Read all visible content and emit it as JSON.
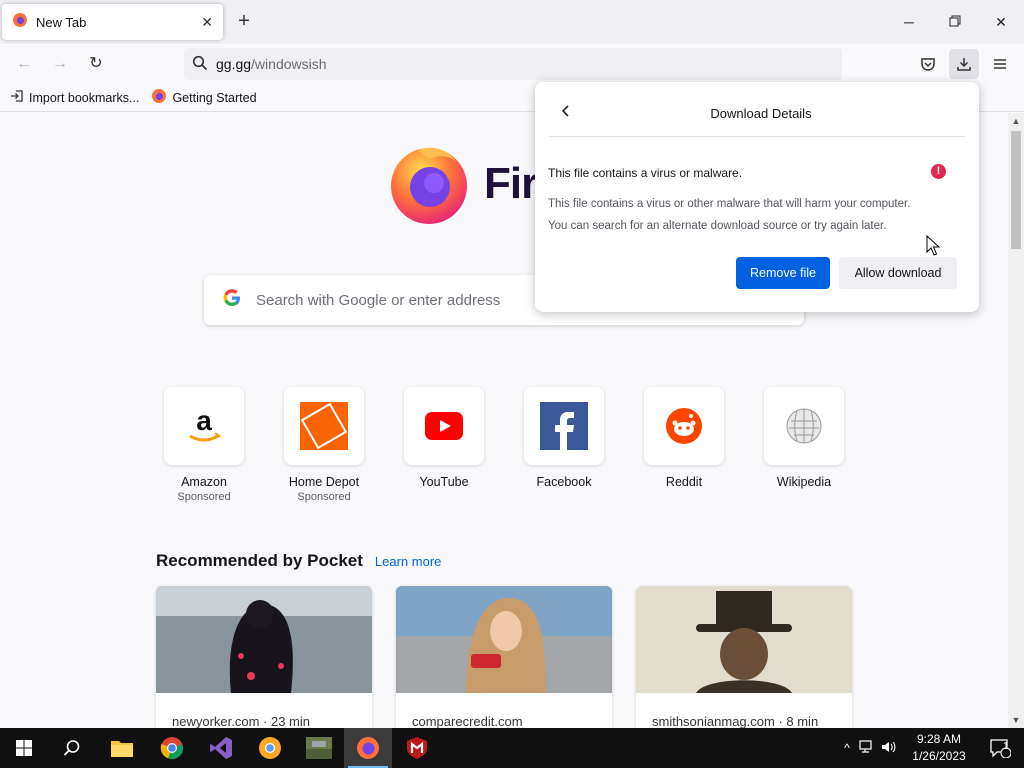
{
  "tab": {
    "title": "New Tab"
  },
  "urlbar": {
    "host": "gg.gg",
    "path": "/windowsish"
  },
  "bookmarks": [
    {
      "label": "Import bookmarks..."
    },
    {
      "label": "Getting Started"
    }
  ],
  "search": {
    "placeholder": "Search with Google or enter address"
  },
  "brand": {
    "partial_text": "Fir"
  },
  "top_sites": [
    {
      "name": "Amazon",
      "sub": "Sponsored"
    },
    {
      "name": "Home Depot",
      "sub": "Sponsored"
    },
    {
      "name": "YouTube",
      "sub": ""
    },
    {
      "name": "Facebook",
      "sub": ""
    },
    {
      "name": "Reddit",
      "sub": ""
    },
    {
      "name": "Wikipedia",
      "sub": ""
    }
  ],
  "pocket": {
    "title": "Recommended by Pocket",
    "learn_more": "Learn more",
    "cards": [
      {
        "source": "newyorker.com · 23 min"
      },
      {
        "source": "comparecredit.com"
      },
      {
        "source": "smithsonianmag.com · 8 min"
      }
    ]
  },
  "download_panel": {
    "title": "Download Details",
    "warning_title": "This file contains a virus or malware.",
    "warning_icon": "!",
    "body_line1": "This file contains a virus or other malware that will harm your computer.",
    "body_line2": "You can search for an alternate download source or try again later.",
    "remove_label": "Remove file",
    "allow_label": "Allow download"
  },
  "clock": {
    "time": "9:28 AM",
    "date": "1/26/2023"
  },
  "notifications": {
    "count": "1"
  },
  "colors": {
    "accent": "#0061e0",
    "warning": "#e22850",
    "taskbar": "#101010"
  }
}
